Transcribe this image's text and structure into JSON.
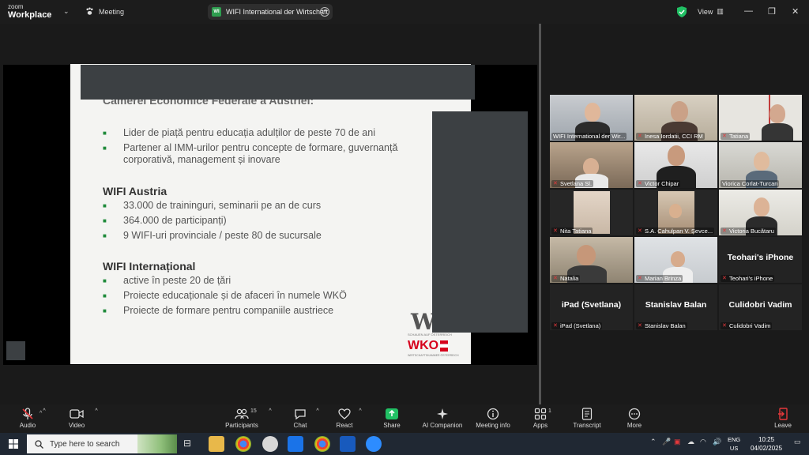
{
  "topbar": {
    "brand_small": "zoom",
    "brand": "Workplace",
    "meeting_label": "Meeting",
    "share_title": "WIFI International der Wirtschaft",
    "share_badge": "WI",
    "view_label": "View"
  },
  "slide": {
    "heading_cut": "Camerei Economice Federale a Austriei:",
    "intro_bullets": [
      "Lider de piață pentru educația adulților de peste 70 de ani",
      "Partener al IMM-urilor pentru concepte de formare, guvernanță corporativă, management și inovare"
    ],
    "section1_title": "WIFI Austria",
    "section1_bullets": [
      "33.000 de traininguri, seminarii pe an de curs",
      "364.000 de participanți)",
      "9 WIFI-uri provinciale / peste 80 de sucursale"
    ],
    "section2_title": "WIFI Internațional",
    "section2_bullets": [
      "active în peste 20 de țări",
      "Proiecte educaționale și de afaceri în numele WKÖ",
      "Proiecte de formare pentru companiile austriece"
    ],
    "logo_text": "WKO",
    "logo_tagline": "SCHAUEN AUF ÖSTERREICH",
    "logo_sub": "WIRTSCHAFTSKAMMER ÖSTERREICH"
  },
  "gallery": [
    {
      "name": "WIFI International der Wir...",
      "muted": false,
      "big": ""
    },
    {
      "name": "Inesa Iordatii, CCI RM",
      "muted": true,
      "big": ""
    },
    {
      "name": "Tatiana",
      "muted": true,
      "big": ""
    },
    {
      "name": "Svetlana Sl.",
      "muted": true,
      "big": ""
    },
    {
      "name": "Victor Chipar",
      "muted": true,
      "big": ""
    },
    {
      "name": "Viorica Corlat-Turcan",
      "muted": false,
      "big": ""
    },
    {
      "name": "Nita Tatiana",
      "muted": true,
      "big": ""
    },
    {
      "name": "S.A. Cahulpan V. Șevce...",
      "muted": true,
      "big": ""
    },
    {
      "name": "Victoria Bucătaru",
      "muted": true,
      "big": ""
    },
    {
      "name": "Natalia",
      "muted": true,
      "big": ""
    },
    {
      "name": "Marian Brinza",
      "muted": true,
      "big": ""
    },
    {
      "name": "Teohari's iPhone",
      "muted": true,
      "big": "Teohari's iPhone"
    },
    {
      "name": "iPad (Svetlana)",
      "muted": true,
      "big": "iPad (Svetlana)"
    },
    {
      "name": "Stanislav Balan",
      "muted": true,
      "big": "Stanislav Balan"
    },
    {
      "name": "Culidobri Vadim",
      "muted": true,
      "big": "Culidobri Vadim"
    }
  ],
  "toolbar": {
    "audio": "Audio",
    "video": "Video",
    "participants": "Participants",
    "participants_count": "15",
    "chat": "Chat",
    "react": "React",
    "share": "Share",
    "ai": "AI Companion",
    "info": "Meeting info",
    "apps": "Apps",
    "apps_count": "1",
    "transcript": "Transcript",
    "more": "More",
    "leave": "Leave"
  },
  "taskbar": {
    "search_placeholder": "Type here to search",
    "lang_top": "ENG",
    "lang_bottom": "US",
    "time": "10:25",
    "date": "04/02/2025"
  },
  "colors": {
    "accent_green": "#37c46b",
    "share_green": "#21c064",
    "mute_red": "#e5383b",
    "wko_red": "#d6001c"
  }
}
